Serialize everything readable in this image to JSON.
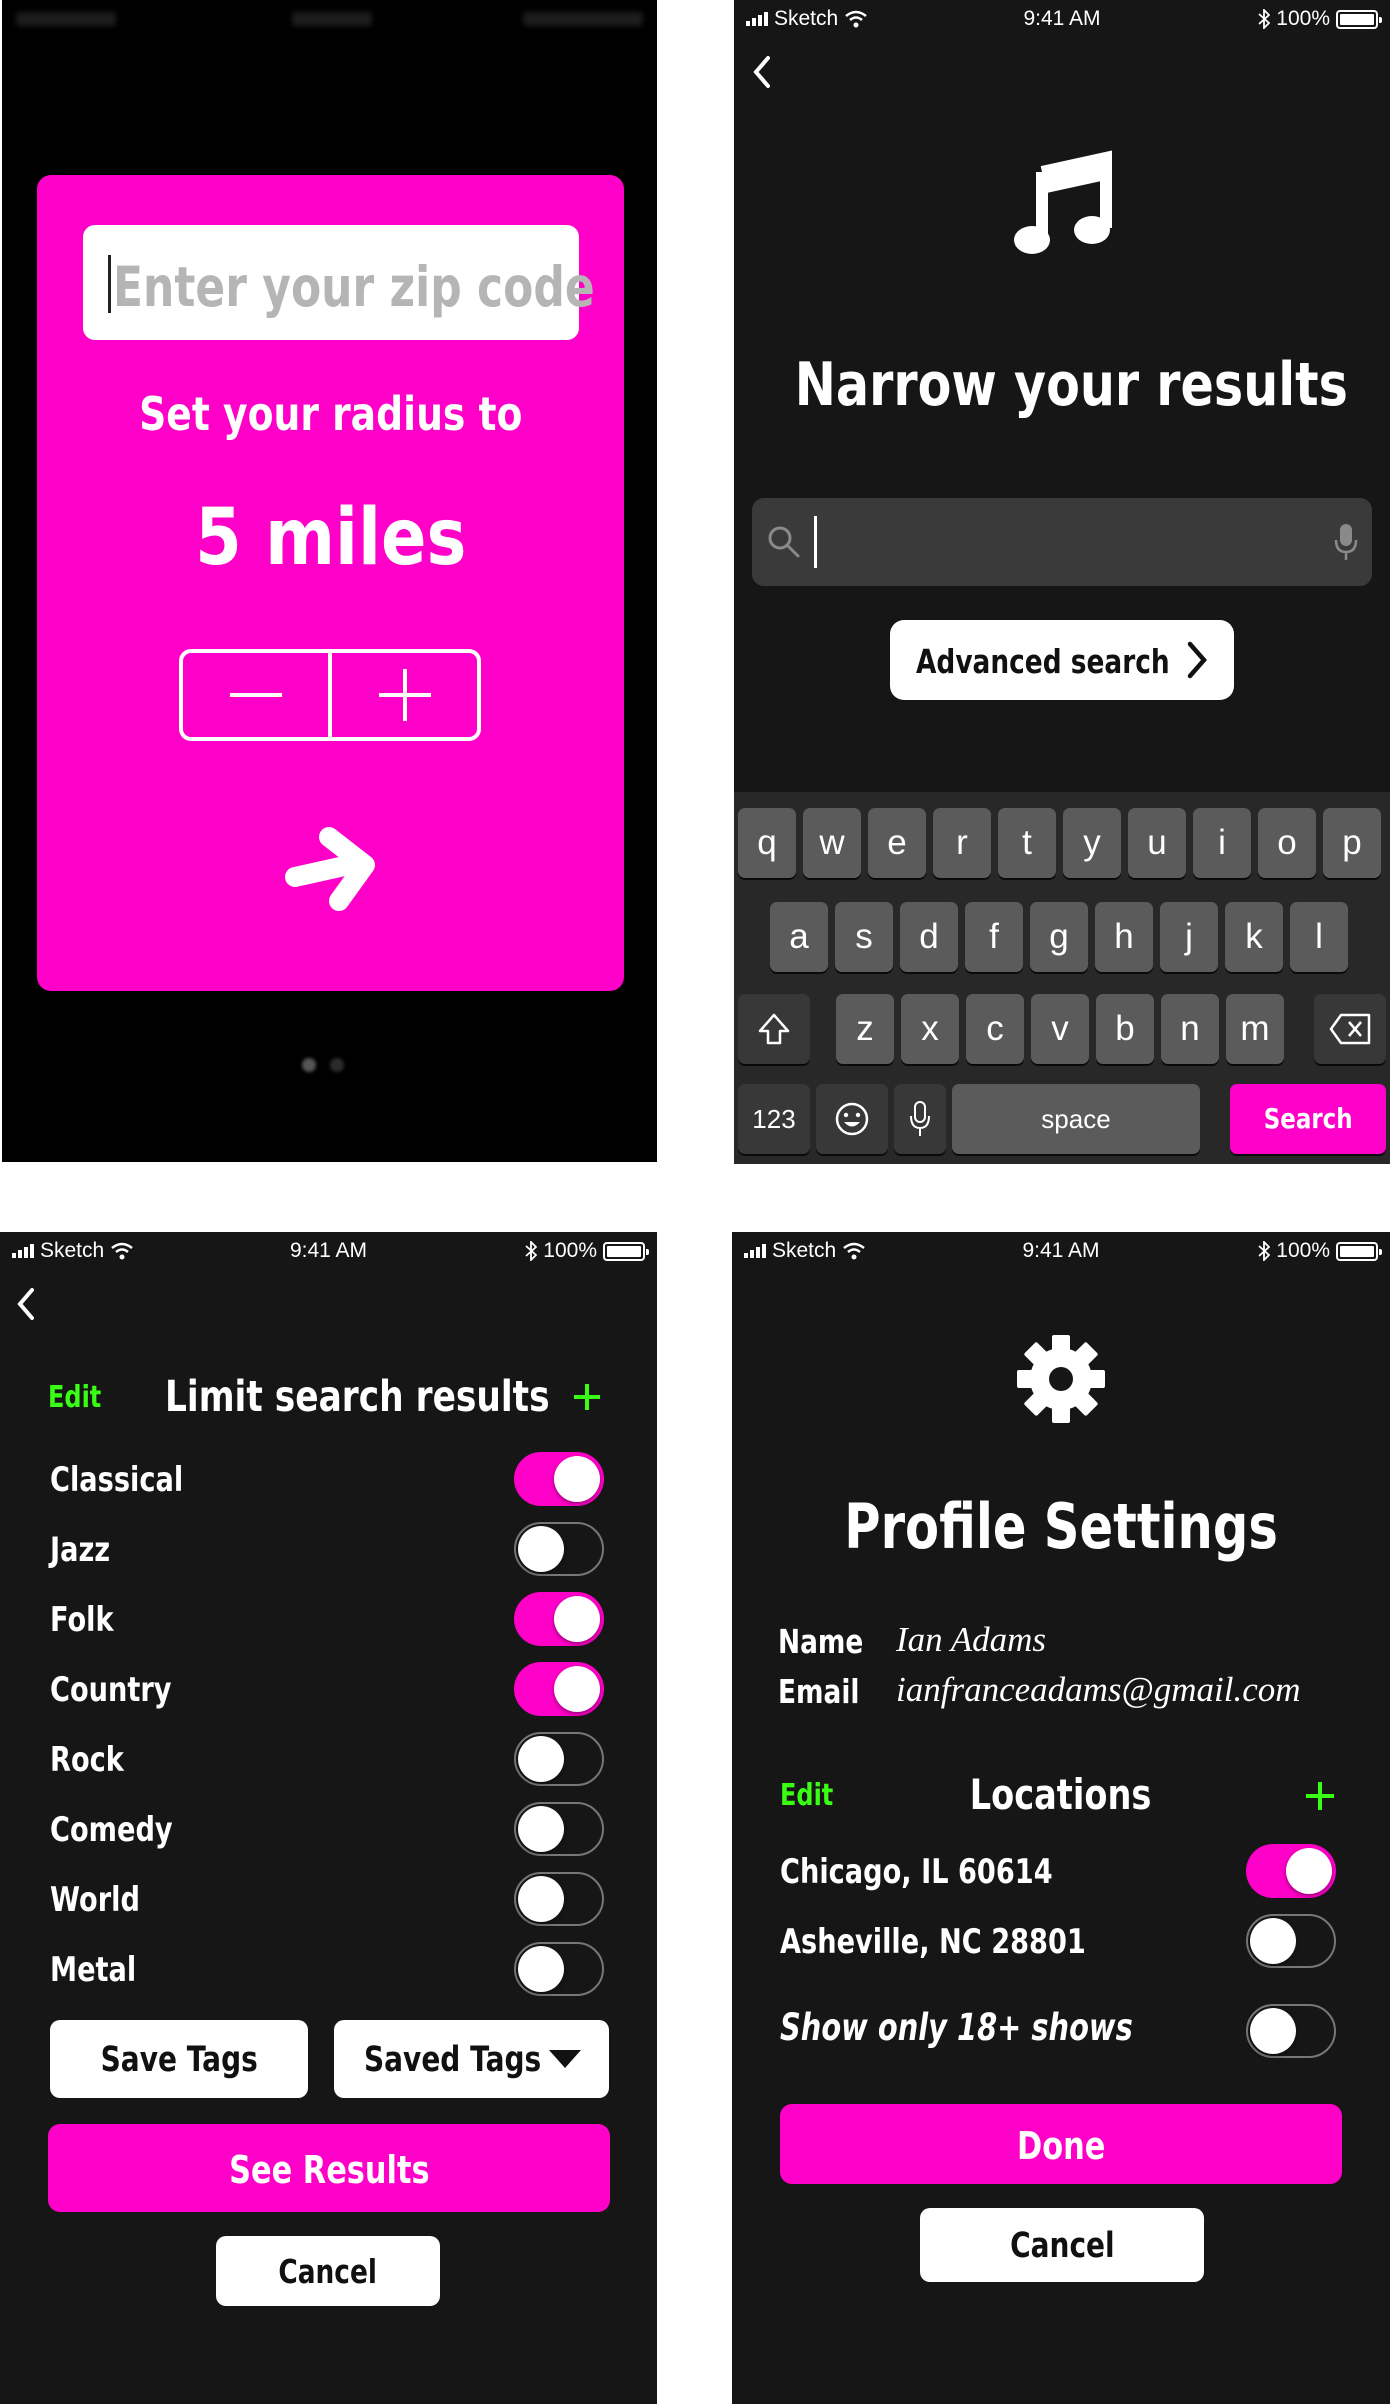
{
  "colors": {
    "accent": "#ff00c8",
    "green": "#39ff14",
    "background": "#161616",
    "keyboard": "#282828"
  },
  "status_bar": {
    "carrier": "Sketch",
    "time": "9:41 AM",
    "battery": "100%"
  },
  "zip_screen": {
    "zip_placeholder": "Enter your zip code",
    "radius_label": "Set your radius to",
    "radius_value": "5 miles",
    "minus_label": "—",
    "plus_label": "+",
    "next_icon": "arrow-right-icon",
    "page_indicator": {
      "pages": 2,
      "current": 1
    }
  },
  "search_screen": {
    "icon": "music-note-icon",
    "title": "Narrow your results",
    "search_value": "",
    "advanced_label": "Advanced search",
    "keyboard": {
      "row1": [
        "q",
        "w",
        "e",
        "r",
        "t",
        "y",
        "u",
        "i",
        "o",
        "p"
      ],
      "row2": [
        "a",
        "s",
        "d",
        "f",
        "g",
        "h",
        "j",
        "k",
        "l"
      ],
      "row3": [
        "z",
        "x",
        "c",
        "v",
        "b",
        "n",
        "m"
      ],
      "numbers_key": "123",
      "space_key": "space",
      "action_key": "Search"
    }
  },
  "filter_screen": {
    "edit_label": "Edit",
    "title": "Limit search results",
    "add_label": "+",
    "genres": [
      {
        "label": "Classical",
        "on": true
      },
      {
        "label": "Jazz",
        "on": false
      },
      {
        "label": "Folk",
        "on": true
      },
      {
        "label": "Country",
        "on": true
      },
      {
        "label": "Rock",
        "on": false
      },
      {
        "label": "Comedy",
        "on": false
      },
      {
        "label": "World",
        "on": false
      },
      {
        "label": "Metal",
        "on": false
      }
    ],
    "save_tags_label": "Save Tags",
    "saved_tags_label": "Saved Tags",
    "see_results_label": "See Results",
    "cancel_label": "Cancel"
  },
  "profile_screen": {
    "icon": "gear-icon",
    "title": "Profile Settings",
    "name_label": "Name",
    "name_value": "Ian Adams",
    "email_label": "Email",
    "email_value": "ianfranceadams@gmail.com",
    "edit_label": "Edit",
    "locations_title": "Locations",
    "add_label": "+",
    "locations": [
      {
        "label": "Chicago, IL 60614",
        "on": true
      },
      {
        "label": "Asheville, NC 28801",
        "on": false
      }
    ],
    "adult_label": "Show only 18+ shows",
    "adult_on": false,
    "done_label": "Done",
    "cancel_label": "Cancel"
  }
}
